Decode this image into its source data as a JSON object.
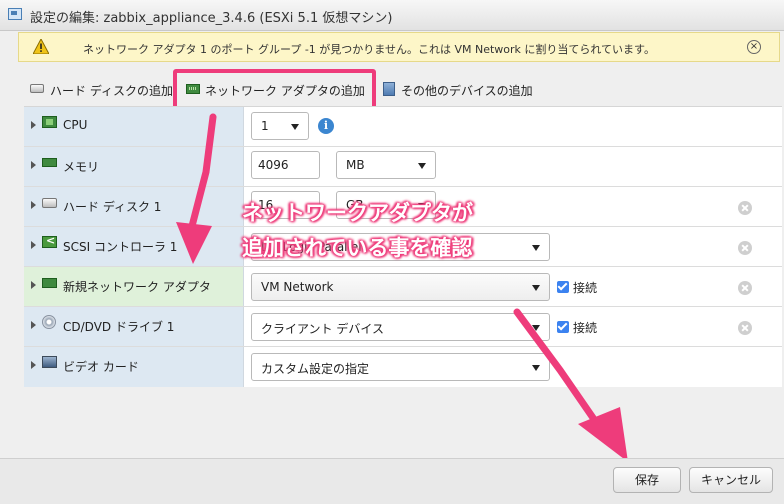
{
  "window": {
    "title": "設定の編集: zabbix_appliance_3.4.6 (ESXi 5.1 仮想マシン)"
  },
  "warning": {
    "text": "ネットワーク アダプタ 1 のポート グループ -1 が見つかりません。これは VM Network に割り当てられています。",
    "close_glyph": "×"
  },
  "toolbar": {
    "add_disk": "ハード ディスクの追加",
    "add_nic": "ネットワーク アダプタの追加",
    "add_other": "その他のデバイスの追加"
  },
  "devices": [
    {
      "label": "CPU",
      "icon": "cpu-icon",
      "value": "1",
      "info_glyph": "i"
    },
    {
      "label": "メモリ",
      "icon": "memory-icon",
      "amount": "4096",
      "unit": "MB"
    },
    {
      "label": "ハード ディスク 1",
      "icon": "disk-icon",
      "amount": "16",
      "unit": "GB"
    },
    {
      "label": "SCSI コントローラ 1",
      "icon": "scsi-icon",
      "value": "LSI Logic Parallel"
    },
    {
      "label": "新規ネットワーク アダプタ",
      "icon": "nic-icon",
      "value": "VM Network",
      "checkbox_label": "接続",
      "checked": true
    },
    {
      "label": "CD/DVD ドライブ 1",
      "icon": "cd-icon",
      "value": "クライアント デバイス",
      "checkbox_label": "接続",
      "checked": true
    },
    {
      "label": "ビデオ カード",
      "icon": "video-icon",
      "value": "カスタム設定の指定"
    }
  ],
  "annotation": {
    "line1": "ネットワークアダプタが",
    "line2": "追加されている事を確認"
  },
  "buttons": {
    "save": "保存",
    "cancel": "キャンセル"
  },
  "colors": {
    "highlight": "#ee3c7b",
    "warning_bg": "#fdf6c8",
    "left_cell": "#dde8f2",
    "selected_cell": "#dff1da"
  }
}
